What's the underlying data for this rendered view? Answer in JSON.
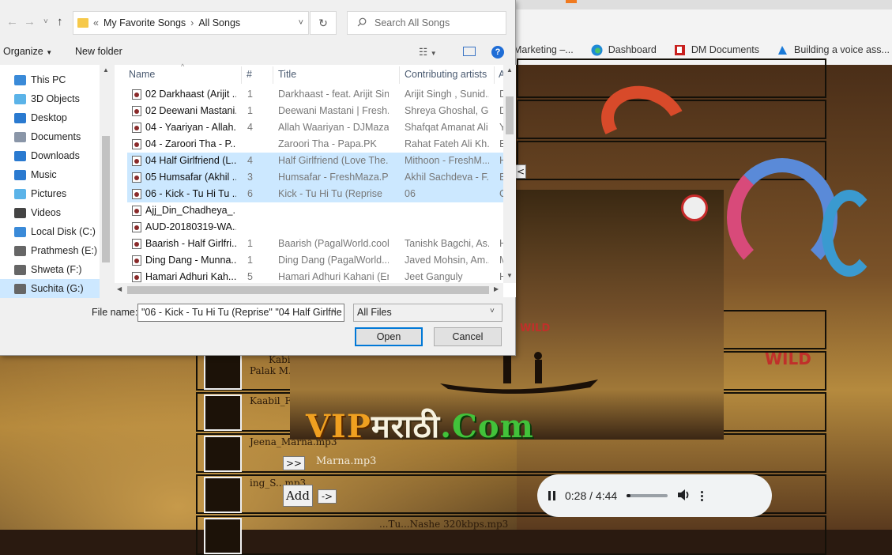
{
  "browser": {
    "bookmarks": [
      {
        "label": "Marketing –...",
        "icon": "bookmark-icon"
      },
      {
        "label": "Dashboard",
        "icon": "edge-icon"
      },
      {
        "label": "DM Documents",
        "icon": "pdf-icon"
      },
      {
        "label": "Building a voice ass...",
        "icon": "azure-icon"
      }
    ]
  },
  "dialog": {
    "breadcrumb": {
      "sep": "«",
      "parent": "My Favorite Songs",
      "current": "All Songs"
    },
    "search_placeholder": "Search All Songs",
    "toolbar": {
      "organize": "Organize",
      "new_folder": "New folder",
      "help": "?"
    },
    "nav_items": [
      {
        "label": "This PC",
        "icon": "pc-icon",
        "color": "#3a8ad8"
      },
      {
        "label": "3D Objects",
        "icon": "cube-icon",
        "color": "#5bb3e8"
      },
      {
        "label": "Desktop",
        "icon": "desktop-icon",
        "color": "#2a7ad0"
      },
      {
        "label": "Documents",
        "icon": "documents-icon",
        "color": "#8a96a8"
      },
      {
        "label": "Downloads",
        "icon": "download-icon",
        "color": "#2a7ad0"
      },
      {
        "label": "Music",
        "icon": "music-icon",
        "color": "#2a7ad0"
      },
      {
        "label": "Pictures",
        "icon": "pictures-icon",
        "color": "#5bb3e8"
      },
      {
        "label": "Videos",
        "icon": "videos-icon",
        "color": "#444"
      },
      {
        "label": "Local Disk (C:)",
        "icon": "drive-icon",
        "color": "#3a8ad8"
      },
      {
        "label": "Prathmesh (E:)",
        "icon": "drive-icon",
        "color": "#666"
      },
      {
        "label": "Shweta (F:)",
        "icon": "drive-icon",
        "color": "#666"
      },
      {
        "label": "Suchita (G:)",
        "icon": "drive-icon",
        "color": "#666",
        "selected": true
      }
    ],
    "columns": {
      "name": "Name",
      "num": "#",
      "title": "Title",
      "artist": "Contributing artists",
      "extra": "A"
    },
    "files": [
      {
        "name": "02 Darkhaast (Arijit ...",
        "num": "1",
        "title": "Darkhaast - feat. Arijit Sin...",
        "artist": "Arijit Singh , Sunid...",
        "extra": "D",
        "selected": false
      },
      {
        "name": "02 Deewani Mastani...",
        "num": "1",
        "title": "Deewani Mastani | Fresh...",
        "artist": "Shreya Ghoshal, G...",
        "extra": "D",
        "selected": false
      },
      {
        "name": "04 - Yaariyan - Allah...",
        "num": "4",
        "title": "Allah Waariyan - DJMaza.I...",
        "artist": "Shafqat Amanat Ali",
        "extra": "Y",
        "selected": false
      },
      {
        "name": "04 - Zaroori Tha - P...",
        "num": "",
        "title": "Zaroori Tha - Papa.PK",
        "artist": "Rahat Fateh Ali Kh...",
        "extra": "E",
        "selected": false
      },
      {
        "name": "04 Half Girlfriend (L...",
        "num": "4",
        "title": "Half Girlfriend (Love The...",
        "artist": "Mithoon - FreshM...",
        "extra": "H",
        "selected": true
      },
      {
        "name": "05 Humsafar (Akhil ...",
        "num": "3",
        "title": "Humsafar - FreshMaza.PK",
        "artist": "Akhil Sachdeva - F...",
        "extra": "E",
        "selected": true
      },
      {
        "name": "06 - Kick - Tu Hi Tu ...",
        "num": "6",
        "title": "Kick - Tu Hi Tu (Reprise",
        "artist": "06",
        "extra": "C",
        "selected": true
      },
      {
        "name": "Ajj_Din_Chadheya_...",
        "num": "",
        "title": "",
        "artist": "",
        "extra": "",
        "selected": false
      },
      {
        "name": "AUD-20180319-WA...",
        "num": "",
        "title": "",
        "artist": "",
        "extra": "",
        "selected": false
      },
      {
        "name": "Baarish - Half Girlfri...",
        "num": "1",
        "title": "Baarish (PagalWorld.cool)",
        "artist": "Tanishk Bagchi, As...",
        "extra": "H",
        "selected": false
      },
      {
        "name": "Ding Dang - Munna...",
        "num": "1",
        "title": "Ding Dang (PagalWorld....",
        "artist": "Javed Mohsin, Am...",
        "extra": "M",
        "selected": false
      },
      {
        "name": "Hamari Adhuri Kah...",
        "num": "5",
        "title": "Hamari Adhuri Kahani (En...",
        "artist": "Jeet Ganguly",
        "extra": "H",
        "selected": false
      }
    ],
    "file_name_label": "File name:",
    "file_name_value": "\"06 - Kick - Tu Hi Tu (Reprise\" \"04 Half Girlfrie",
    "file_type": "All Files",
    "open_label": "Open",
    "cancel_label": "Cancel"
  },
  "page": {
    "playlist": [
      {
        "line1": "Kabi...",
        "line2": "Palak M..."
      },
      {
        "line1": "Kaabil_F...",
        "line2": ""
      },
      {
        "line1": "Jeena_Marna.mp3",
        "line2": ""
      },
      {
        "line1": "ing_S...mp3",
        "line2": ""
      },
      {
        "line1": "...Tu...Nashe 320kbps.mp3",
        "line2": ""
      }
    ],
    "next_label": ">>",
    "marna_text": "Marna.mp3",
    "add_label": "Add",
    "arrow_label": "->",
    "collapse_label": "<",
    "vip_logo": {
      "part1": "VIP",
      "part2": "मराठी",
      "part3": ".Com"
    },
    "wild_label": "WILD"
  },
  "player": {
    "current": "0:28",
    "duration": "4:44",
    "progress_fraction": 0.1
  }
}
